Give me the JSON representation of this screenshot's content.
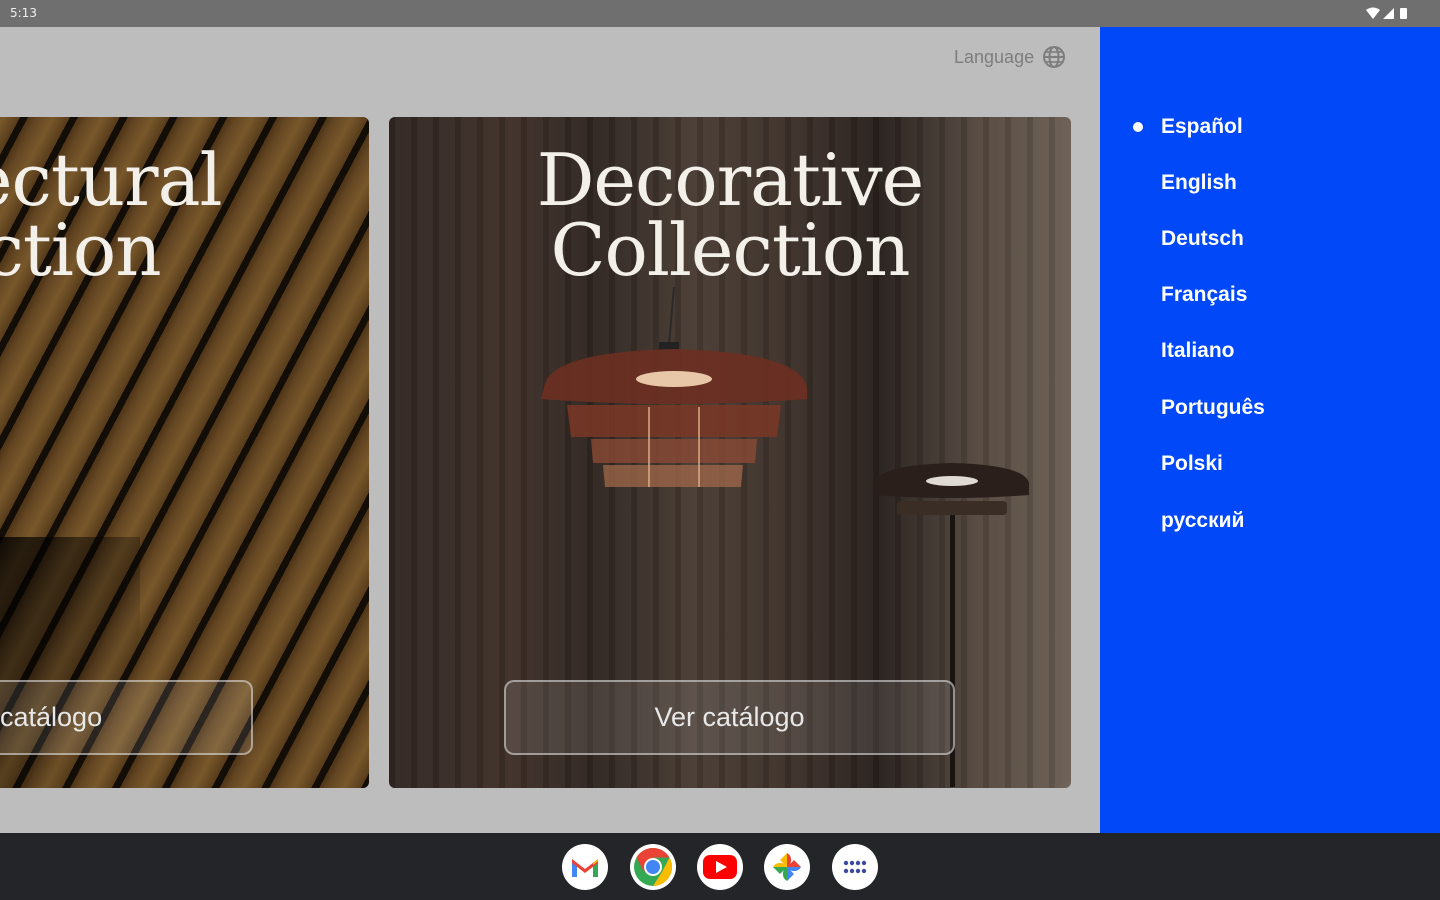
{
  "status_bar": {
    "time": "5:13"
  },
  "header": {
    "language_label": "Language"
  },
  "cards": [
    {
      "title_line1": "tectural",
      "title_line2": "ection",
      "cta": "catálogo"
    },
    {
      "title_line1": "Decorative",
      "title_line2": "Collection",
      "cta": "Ver catálogo"
    }
  ],
  "language_panel": {
    "selected": "Español",
    "items": [
      "Español",
      "English",
      "Deutsch",
      "Français",
      "Italiano",
      "Português",
      "Polski",
      "русский"
    ]
  },
  "dock": {
    "apps": [
      "gmail-icon",
      "chrome-icon",
      "youtube-icon",
      "photos-icon",
      "app-launcher-icon"
    ]
  },
  "colors": {
    "panel": "#0048f8",
    "content_bg": "#bdbdbd",
    "taskbar": "#242529"
  }
}
